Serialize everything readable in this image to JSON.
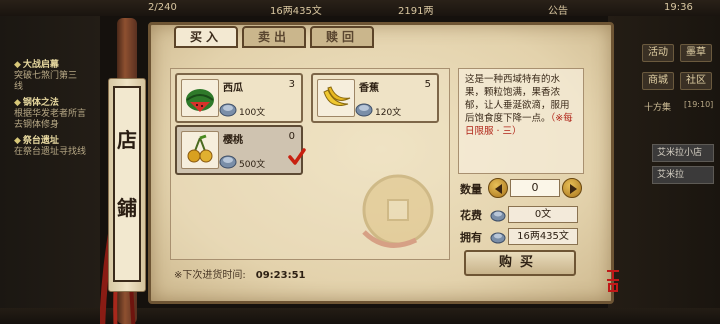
{
  "topbar": {
    "energy": "2/240",
    "silver": "16两435文",
    "gold": "2191两",
    "announcement": "公告",
    "clock": "19:36"
  },
  "quests": [
    {
      "title": "大战启幕",
      "desc": "突破七煞门第三",
      "extra": "线"
    },
    {
      "title": "钢体之法",
      "desc": "根据华发老者所言",
      "extra": "去钢体修身"
    },
    {
      "title": "祭台遗址",
      "desc": "在祭台遗址寻找线",
      "extra": ""
    }
  ],
  "right_hud": {
    "buttons": [
      "活动",
      "墨草",
      "商城",
      "社区"
    ],
    "chat_tabs": [
      "十方集",
      "[19:10]"
    ],
    "list": [
      "艾米拉小店",
      "艾米拉"
    ]
  },
  "shop": {
    "title_chars": [
      "店",
      "鋪"
    ],
    "tabs": [
      "买入",
      "卖出",
      "赎回"
    ],
    "active_tab": "买入",
    "items": [
      {
        "name": "西瓜",
        "qty": "3",
        "price": "100文",
        "icon": "watermelon-icon"
      },
      {
        "name": "香蕉",
        "qty": "5",
        "price": "120文",
        "icon": "banana-icon"
      },
      {
        "name": "樱桃",
        "qty": "0",
        "price": "500文",
        "icon": "cherry-icon",
        "selected": true
      }
    ],
    "restock_label": "※下次进货时间:",
    "restock_time": "09:23:51",
    "description": "这是一种西域特有的水果，颗粒饱满，果香浓郁，让人垂涎欲滴，服用后饱食度下降一点。",
    "limit_note": "（※每日限服 · 三）",
    "quantity_label": "数量",
    "quantity_value": "0",
    "cost_label": "花费",
    "cost_value": "0文",
    "owned_label": "拥有",
    "owned_value": "16两435文",
    "buy_label": "购买"
  },
  "colors": {
    "panel_bg": "#e6d8b6",
    "border": "#6e5534",
    "limit_red": "#b02418",
    "seal_red": "#c01818"
  }
}
